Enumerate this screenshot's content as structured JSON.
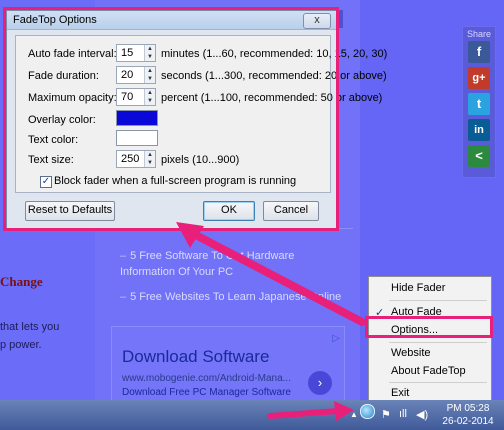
{
  "dialog": {
    "title": "FadeTop Options",
    "close_label": "x",
    "rows": [
      {
        "label": "Auto fade interval:",
        "value": "15",
        "hint": "minutes (1...60, recommended: 10, 15, 20, 30)"
      },
      {
        "label": "Fade duration:",
        "value": "20",
        "hint": "seconds (1...300, recommended: 20 or above)"
      },
      {
        "label": "Maximum opacity:",
        "value": "70",
        "hint": "percent (1...100, recommended: 50 or above)"
      },
      {
        "label": "Overlay color:"
      },
      {
        "label": "Text color:"
      },
      {
        "label": "Text size:",
        "value": "250",
        "hint": "pixels (10...900)"
      }
    ],
    "overlay_color": "#0a08d8",
    "text_color": "#ffffff",
    "checkbox_label": "Block fader when a full-screen program is running",
    "checkbox_checked": true,
    "reset_label": "Reset to Defaults",
    "ok_label": "OK",
    "cancel_label": "Cancel"
  },
  "context_menu": {
    "items": [
      {
        "label": "Hide Fader"
      },
      {
        "label": "Auto Fade",
        "checked": true
      },
      {
        "label": "Options..."
      },
      {
        "label": "Website"
      },
      {
        "label": "About FadeTop"
      },
      {
        "label": "Exit"
      }
    ]
  },
  "background": {
    "heading": "Change",
    "text_line1": "that lets you",
    "text_line2": "p power.",
    "links": [
      {
        "line1": "5 Free Software To Get Hardware",
        "line2": "Information Of Your PC"
      },
      {
        "line1": "5 Free Websites To Learn Japanese Online"
      }
    ],
    "ad": {
      "title": "Download Software",
      "url": "www.mobogenie.com/Android-Mana...",
      "desc": "Download Free PC Manager Software",
      "arrow": "›"
    },
    "share_label": "Share",
    "share_buttons": [
      {
        "icon": "facebook-icon",
        "glyph": "f",
        "color": "#3b5998"
      },
      {
        "icon": "google-plus-icon",
        "glyph": "g+",
        "color": "#c13a2a"
      },
      {
        "icon": "twitter-icon",
        "glyph": "t",
        "color": "#2aa3e0"
      },
      {
        "icon": "linkedin-icon",
        "glyph": "in",
        "color": "#0a5c94"
      },
      {
        "icon": "share-icon",
        "glyph": "<",
        "color": "#2b8a3e"
      }
    ]
  },
  "taskbar": {
    "time": "PM 05:28",
    "date": "26-02-2014",
    "tray_up_arrow": "▲",
    "flag_glyph": "⚑",
    "signal_glyph": "ıll",
    "volume_glyph": "◀)"
  },
  "colors": {
    "highlight": "#e8207a"
  }
}
